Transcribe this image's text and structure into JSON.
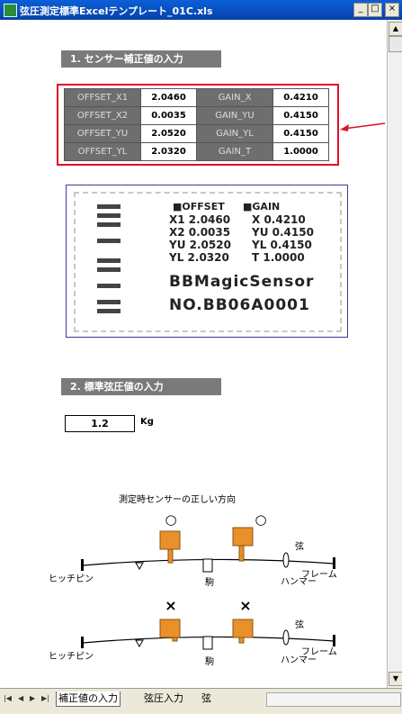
{
  "window": {
    "title": "弦圧測定標準Excelテンプレート_01C.xls",
    "minimize": "_",
    "restore": "□",
    "close": "×"
  },
  "section1": {
    "title": "1. センサー補正値の入力"
  },
  "offset_rows": [
    {
      "label1": "OFFSET_X1",
      "val1": "2.0460",
      "label2": "GAIN_X",
      "val2": "0.4210"
    },
    {
      "label1": "OFFSET_X2",
      "val1": "0.0035",
      "label2": "GAIN_YU",
      "val2": "0.4150"
    },
    {
      "label1": "OFFSET_YU",
      "val1": "2.0520",
      "label2": "GAIN_YL",
      "val2": "0.4150"
    },
    {
      "label1": "OFFSET_YL",
      "val1": "2.0320",
      "label2": "GAIN_T",
      "val2": "1.0000"
    }
  ],
  "sticker": {
    "header_offset": "OFFSET",
    "header_gain": "GAIN",
    "rows": [
      {
        "k1": "X1",
        "v1": "2.0460",
        "k2": "X",
        "v2": "0.4210"
      },
      {
        "k1": "X2",
        "v1": "0.0035",
        "k2": "YU",
        "v2": "0.4150"
      },
      {
        "k1": "YU",
        "v1": "2.0520",
        "k2": "YL",
        "v2": "0.4150"
      },
      {
        "k1": "YL",
        "v1": "2.0320",
        "k2": "T",
        "v2": "1.0000"
      }
    ],
    "brand": "BBMagicSensor",
    "serial": "NO.BB06A0001"
  },
  "section2": {
    "title": "2. 標準弦圧値の入力"
  },
  "tension": {
    "value": "1.2",
    "unit": "Kg"
  },
  "diagram": {
    "title": "測定時センサーの正しい方向",
    "correct_mark": "○",
    "wrong_mark": "×",
    "label_hitch": "ヒッチピン",
    "label_bridge": "駒",
    "label_hammer": "ハンマー",
    "label_frame": "フレーム",
    "label_string": "弦"
  },
  "sheet_tabs": {
    "nav": [
      "|◀",
      "◀",
      "▶",
      "▶|"
    ],
    "tabs": [
      "補正値の入力",
      "弦圧入力",
      "弦"
    ]
  }
}
